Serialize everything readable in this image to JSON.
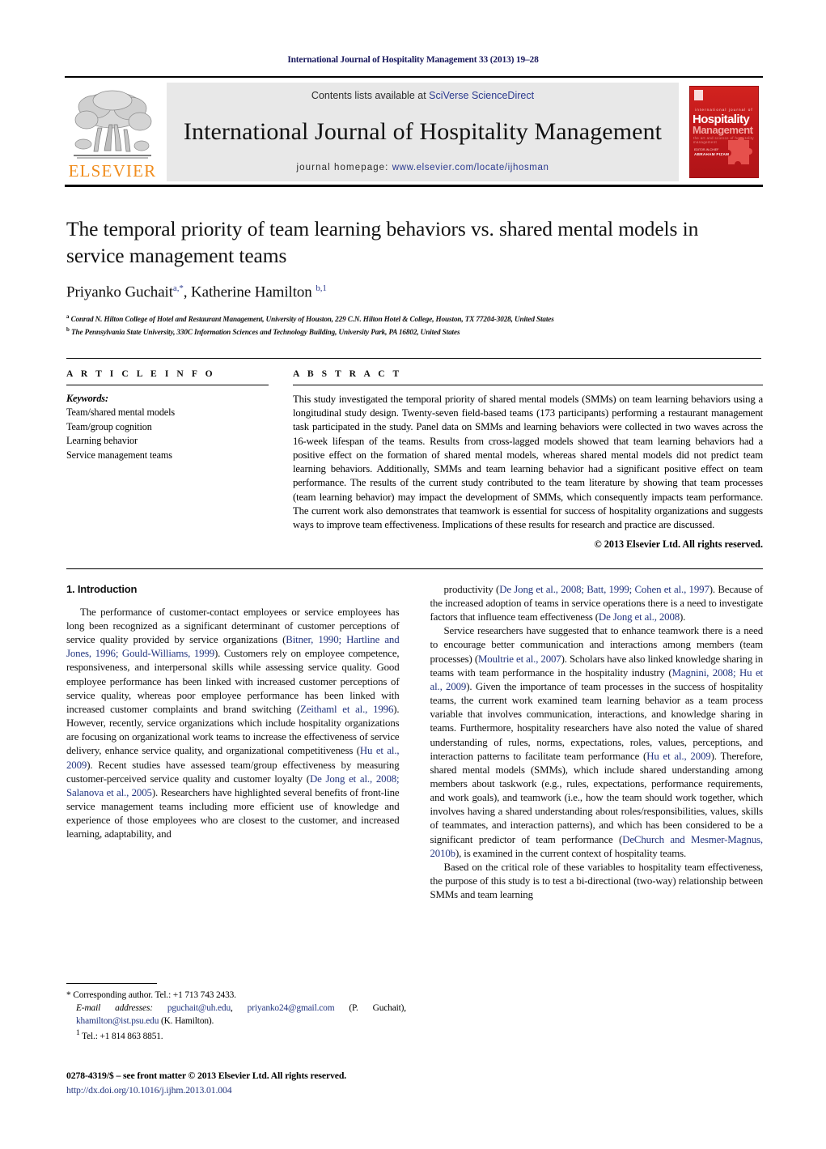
{
  "running_head": "International Journal of Hospitality Management 33 (2013) 19–28",
  "masthead": {
    "publisher_name": "ELSEVIER",
    "contents_prefix": "Contents lists available at ",
    "contents_link": "SciVerse ScienceDirect",
    "journal_title": "International Journal of Hospitality Management",
    "homepage_prefix": "journal homepage: ",
    "homepage_url": "www.elsevier.com/locate/ijhosman",
    "cover": {
      "sub": "international journal of",
      "line1": "Hospitality",
      "line2": "Management",
      "line3": "the art and science of hospitality management",
      "editor_label": "EDITOR-IN-CHIEF",
      "editor_name": "ABRAHAM PIZAM"
    },
    "accent_orange": "#f08c1c",
    "link_blue": "#2b3a8f",
    "cover_red": "#c2181b"
  },
  "article": {
    "title": "The temporal priority of team learning behaviors vs. shared mental models in service management teams",
    "authors_html": "Priyanko Guchait<sup class=\"ast\">a,*</sup>, Katherine Hamilton <sup>b,1</sup>",
    "affiliation_a": "Conrad N. Hilton College of Hotel and Restaurant Management, University of Houston, 229 C.N. Hilton Hotel &amp; College, Houston, TX 77204-3028, United States",
    "affiliation_b": "The Pennsylvania State University, 330C Information Sciences and Technology Building, University Park, PA 16802, United States",
    "affiliation_a_marker": "a",
    "affiliation_b_marker": "b"
  },
  "article_info": {
    "heading": "A R T I C L E   I N F O",
    "keywords_label": "Keywords:",
    "keywords": [
      "Team/shared mental models",
      "Team/group cognition",
      "Learning behavior",
      "Service management teams"
    ]
  },
  "abstract": {
    "heading": "A B S T R A C T",
    "text": "This study investigated the temporal priority of shared mental models (SMMs) on team learning behaviors using a longitudinal study design. Twenty-seven field-based teams (173 participants) performing a restaurant management task participated in the study. Panel data on SMMs and learning behaviors were collected in two waves across the 16-week lifespan of the teams. Results from cross-lagged models showed that team learning behaviors had a positive effect on the formation of shared mental models, whereas shared mental models did not predict team learning behaviors. Additionally, SMMs and team learning behavior had a significant positive effect on team performance. The results of the current study contributed to the team literature by showing that team processes (team learning behavior) may impact the development of SMMs, which consequently impacts team performance. The current work also demonstrates that teamwork is essential for success of hospitality organizations and suggests ways to improve team effectiveness. Implications of these results for research and practice are discussed.",
    "copyright": "© 2013 Elsevier Ltd. All rights reserved."
  },
  "body": {
    "section_heading": "1.  Introduction",
    "left_paragraphs_html": [
      "The performance of customer-contact employees or service employees has long been recognized as a significant determinant of customer perceptions of service quality provided by service organizations (<span class=\"cite\">Bitner, 1990; Hartline and Jones, 1996; Gould-Williams, 1999</span>). Customers rely on employee competence, responsiveness, and interpersonal skills while assessing service quality. Good employee performance has been linked with increased customer perceptions of service quality, whereas poor employee performance has been linked with increased customer complaints and brand switching (<span class=\"cite\">Zeithaml et al., 1996</span>). However, recently, service organizations which include hospitality organizations are focusing on organizational work teams to increase the effectiveness of service delivery, enhance service quality, and organizational competitiveness (<span class=\"cite\">Hu et al., 2009</span>). Recent studies have assessed team/group effectiveness by measuring customer-perceived service quality and customer loyalty (<span class=\"cite\">De Jong et al., 2008; Salanova et al., 2005</span>). Researchers have highlighted several benefits of front-line service management teams including more efficient use of knowledge and experience of those employees who are closest to the customer, and increased learning, adaptability, and"
    ],
    "right_paragraphs_html": [
      "productivity (<span class=\"cite\">De Jong et al., 2008; Batt, 1999; Cohen et al., 1997</span>). Because of the increased adoption of teams in service operations there is a need to investigate factors that influence team effectiveness (<span class=\"cite\">De Jong et al., 2008</span>).",
      "Service researchers have suggested that to enhance teamwork there is a need to encourage better communication and interactions among members (team processes) (<span class=\"cite\">Moultrie et al., 2007</span>). Scholars have also linked knowledge sharing in teams with team performance in the hospitality industry (<span class=\"cite\">Magnini, 2008; Hu et al., 2009</span>). Given the importance of team processes in the success of hospitality teams, the current work examined team learning behavior as a team process variable that involves communication, interactions, and knowledge sharing in teams. Furthermore, hospitality researchers have also noted the value of shared understanding of rules, norms, expectations, roles, values, perceptions, and interaction patterns to facilitate team performance (<span class=\"cite\">Hu et al., 2009</span>). Therefore, shared mental models (SMMs), which include shared understanding among members about taskwork (e.g., rules, expectations, performance requirements, and work goals), and teamwork (i.e., how the team should work together, which involves having a shared understanding about roles/responsibilities, values, skills of teammates, and interaction patterns), and which has been considered to be a significant predictor of team performance (<span class=\"cite\">DeChurch and Mesmer-Magnus, 2010b</span>), is examined in the current context of hospitality teams.",
      "Based on the critical role of these variables to hospitality team effectiveness, the purpose of this study is to test a bi-directional (two-way) relationship between SMMs and team learning"
    ]
  },
  "footnotes": {
    "corresponding_html": "* Corresponding author. Tel.: +1 713 743 2433.",
    "email_html": "<span class=\"indent\"><i>E-mail addresses:</i> <span class=\"mail\">pguchait@uh.edu</span>, <span class=\"mail\">priyanko24@gmail.com</span> (P. Guchait), <span class=\"mail\">khamilton@ist.psu.edu</span> (K. Hamilton).</span>",
    "tel_html": "<span class=\"indent\"><sup>1</sup> Tel.: +1 814 863 8851.</span>"
  },
  "imprint": {
    "issn_line": "0278-4319/$ – see front matter © 2013 Elsevier Ltd. All rights reserved.",
    "doi": "http://dx.doi.org/10.1016/j.ijhm.2013.01.004"
  }
}
